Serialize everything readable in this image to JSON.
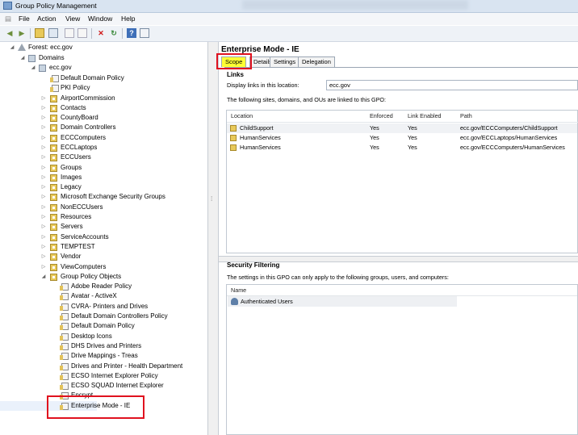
{
  "window": {
    "title": "Group Policy Management"
  },
  "menu": [
    "File",
    "Action",
    "View",
    "Window",
    "Help"
  ],
  "toolbar": {
    "icons": [
      "back-arrow-icon",
      "forward-arrow-icon",
      "up-folder-icon",
      "show-tree-icon",
      "copy-icon",
      "paste-icon",
      "delete-icon",
      "refresh-icon",
      "help-icon",
      "properties-icon"
    ]
  },
  "tree": {
    "forest": "Forest: ecc.gov",
    "domains": "Domains",
    "domain": "ecc.gov",
    "domain_items": [
      "Default Domain Policy",
      "PKI Policy",
      "AirportCommission",
      "Contacts",
      "CountyBoard",
      "Domain Controllers",
      "ECCComputers",
      "ECCLaptops",
      "ECCUsers",
      "Groups",
      "Images",
      "Legacy",
      "Microsoft Exchange Security Groups",
      "NonECCUsers",
      "Resources",
      "Servers",
      "ServiceAccounts",
      "TEMPTEST",
      "Vendor",
      "ViewComputers"
    ],
    "gpo_folder": "Group Policy Objects",
    "gpos": [
      "Adobe Reader Policy",
      "Avatar - ActiveX",
      "CVRA- Printers and Drives",
      "Default Domain Controllers Policy",
      "Default Domain Policy",
      "Desktop Icons",
      "DHS Drives and Printers",
      "Drive Mappings - Treas",
      "Drives and Printer - Health Department",
      "ECSO Internet Explorer Policy",
      "ECSO SQUAD Internet Explorer",
      "Encrypt",
      "Enterprise Mode - IE"
    ]
  },
  "pane": {
    "title": "Enterprise Mode - IE",
    "tabs": [
      "Scope",
      "Details",
      "Settings",
      "Delegation"
    ],
    "links": {
      "heading": "Links",
      "display_label": "Display links in this location:",
      "location_value": "ecc.gov",
      "description": "The following sites, domains, and OUs are linked to this GPO:",
      "columns": [
        "Location",
        "Enforced",
        "Link Enabled",
        "Path"
      ],
      "rows": [
        [
          "ChildSupport",
          "Yes",
          "Yes",
          "ecc.gov/ECCComputers/ChildSupport"
        ],
        [
          "HumanServices",
          "Yes",
          "Yes",
          "ecc.gov/ECCLaptops/HumanServices"
        ],
        [
          "HumanServices",
          "Yes",
          "Yes",
          "ecc.gov/ECCComputers/HumanServices"
        ]
      ]
    },
    "security": {
      "heading": "Security Filtering",
      "description": "The settings in this GPO can only apply to the following groups, users, and computers:",
      "column": "Name",
      "rows": [
        "Authenticated Users"
      ]
    }
  },
  "highlight_color": "#e0121f"
}
